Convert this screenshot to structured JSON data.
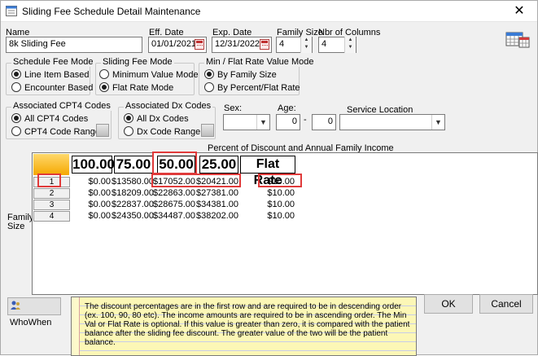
{
  "window": {
    "title": "Sliding Fee Schedule Detail Maintenance",
    "close": "✕"
  },
  "fields": {
    "name_label": "Name",
    "name_value": "8k Sliding Fee",
    "eff_label": "Eff. Date",
    "eff_value": "01/01/2021",
    "exp_label": "Exp. Date",
    "exp_value": "12/31/2022",
    "family_size_label": "Family Size",
    "family_size_value": "4",
    "nbr_cols_label": "Nbr of Columns",
    "nbr_cols_value": "4"
  },
  "schedule_fee_mode": {
    "title": "Schedule Fee Mode",
    "options": [
      {
        "label": "Line Item Based",
        "selected": true
      },
      {
        "label": "Encounter Based",
        "selected": false
      }
    ]
  },
  "sliding_fee_mode": {
    "title": "Sliding Fee Mode",
    "options": [
      {
        "label": "Minimum Value Mode",
        "selected": false
      },
      {
        "label": "Flat Rate Mode",
        "selected": true
      }
    ]
  },
  "min_flat_mode": {
    "title": "Min / Flat Rate Value Mode",
    "options": [
      {
        "label": "By Family Size",
        "selected": true
      },
      {
        "label": "By Percent/Flat Rate",
        "selected": false
      }
    ]
  },
  "cpt4_codes": {
    "title": "Associated CPT4 Codes",
    "options": [
      {
        "label": "All CPT4 Codes",
        "selected": true
      },
      {
        "label": "CPT4 Code Range",
        "selected": false
      }
    ]
  },
  "dx_codes": {
    "title": "Associated Dx Codes",
    "options": [
      {
        "label": "All Dx Codes",
        "selected": true
      },
      {
        "label": "Dx Code Range",
        "selected": false
      }
    ]
  },
  "filters": {
    "sex_label": "Sex:",
    "age_label": "Age:",
    "age_from": "0",
    "age_sep": "-",
    "age_to": "0",
    "location_label": "Service Location"
  },
  "grid": {
    "caption": "Percent of Discount and Annual Family Income",
    "side_label_1": "Family",
    "side_label_2": "Size",
    "headers": [
      "100.00",
      "75.00",
      "50.00",
      "25.00",
      "Flat Rate"
    ],
    "rows": [
      {
        "num": "1",
        "cells": [
          "$0.00",
          "$13580.00",
          "$17052.00",
          "$20421.00",
          "$10.00"
        ]
      },
      {
        "num": "2",
        "cells": [
          "$0.00",
          "$18209.00",
          "$22863.00",
          "$27381.00",
          "$10.00"
        ]
      },
      {
        "num": "3",
        "cells": [
          "$0.00",
          "$22837.00",
          "$28675.00",
          "$34381.00",
          "$10.00"
        ]
      },
      {
        "num": "4",
        "cells": [
          "$0.00",
          "$24350.00",
          "$34487.00",
          "$38202.00",
          "$10.00"
        ]
      }
    ]
  },
  "footer": {
    "whowhen_label": "WhoWhen",
    "note": "The discount percentages are in the first row and are required to be in descending order (ex. 100, 90, 80 etc).  The income amounts are required to be in ascending order.  The Min Val or Flat Rate is optional.  If this value is greater than zero, it is compared with the patient balance after the sliding fee discount.  The greater value of the two will be the patient balance.",
    "ok_label": "OK",
    "cancel_label": "Cancel"
  },
  "colors": {
    "highlight_red": "#e03a3a",
    "note_yellow": "#fcf7b6",
    "corner_orange": "#f5a800"
  }
}
